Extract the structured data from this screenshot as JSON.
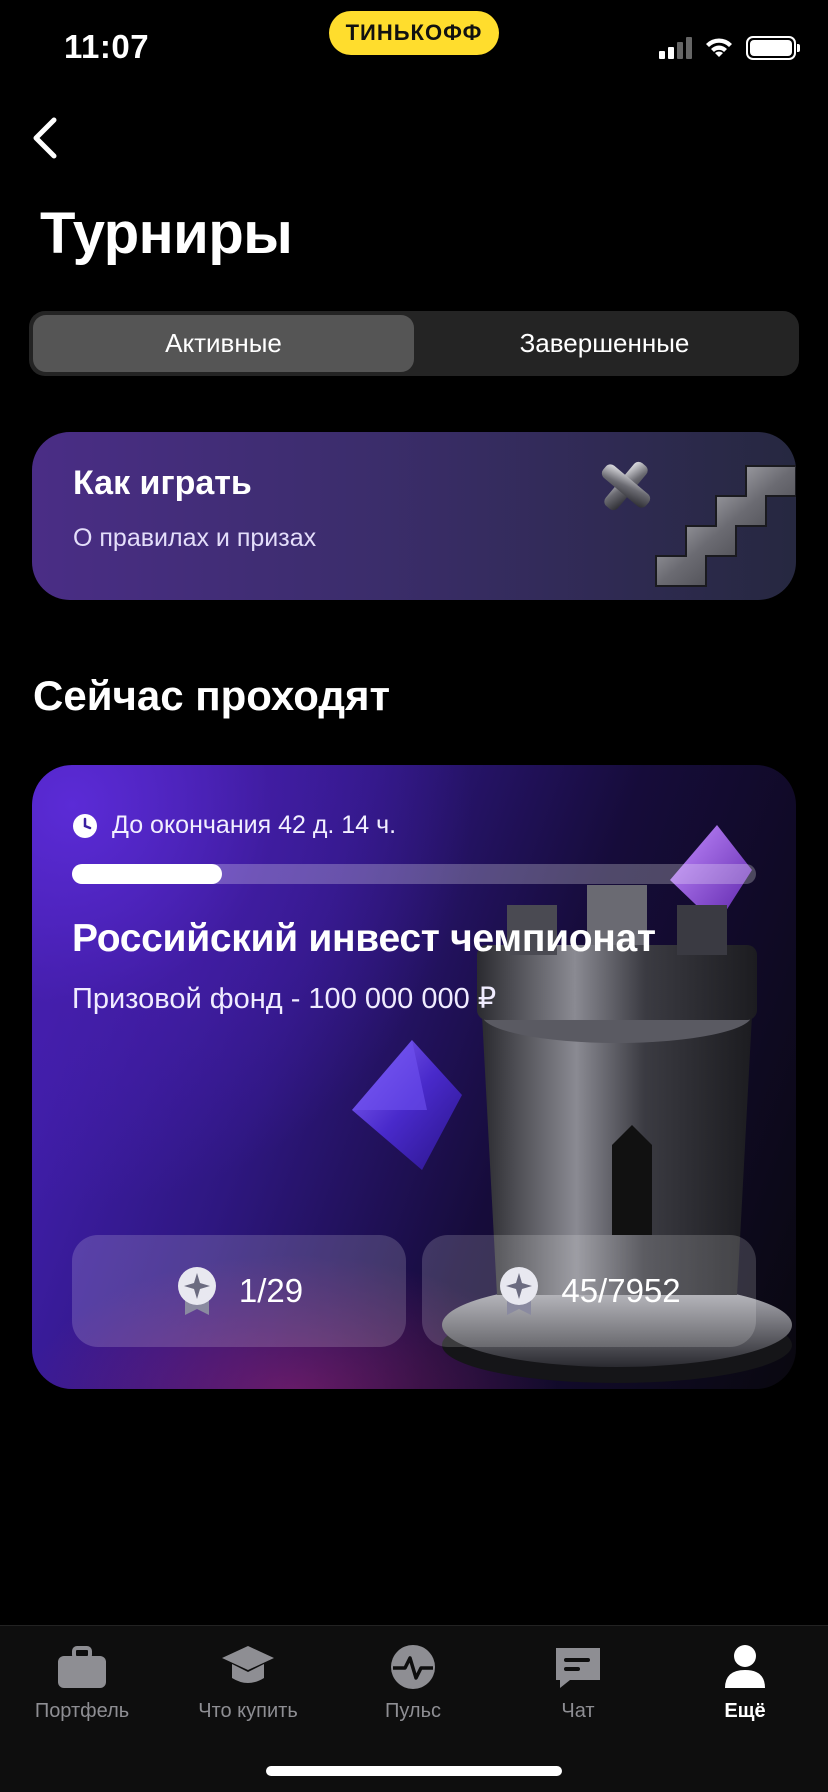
{
  "status_bar": {
    "time": "11:07",
    "brand": "ТИНЬКОФФ"
  },
  "header": {
    "title": "Турниры"
  },
  "segments": {
    "active": "Активные",
    "finished": "Завершенные"
  },
  "howto": {
    "title": "Как играть",
    "subtitle": "О правилах и призах"
  },
  "section": {
    "title": "Сейчас проходят"
  },
  "tournament": {
    "timer": "До окончания 42 д. 14 ч.",
    "progress": 0.22,
    "title": "Российский инвест чемпионат",
    "prize": "Призовой фонд - 100 000 000 ₽",
    "stat_1": "1/29",
    "stat_2": "45/7952"
  },
  "tabbar": {
    "items": [
      {
        "label": "Портфель",
        "icon": "briefcase-icon"
      },
      {
        "label": "Что купить",
        "icon": "graduation-cap-icon"
      },
      {
        "label": "Пульс",
        "icon": "pulse-icon"
      },
      {
        "label": "Чат",
        "icon": "chat-icon"
      },
      {
        "label": "Ещё",
        "icon": "profile-icon",
        "active": true
      }
    ]
  },
  "colors": {
    "brand": "#ffdd2d",
    "accent_purple": "#5b2bd6",
    "background": "#000000"
  }
}
